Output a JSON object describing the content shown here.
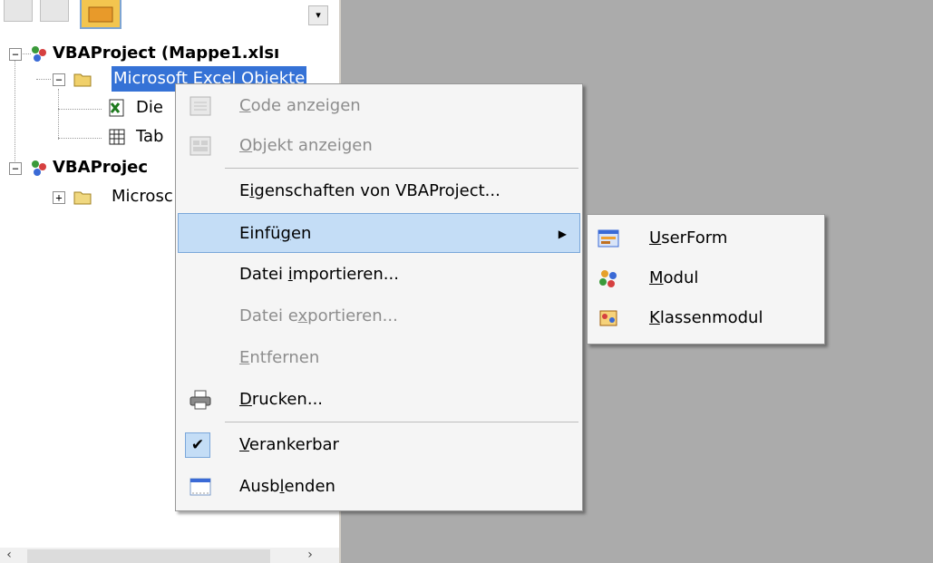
{
  "tree": {
    "project1": "VBAProject (Mappe1.xlsı",
    "folder1": "Microsoft Excel Objekte",
    "item_die": "Die",
    "item_tab": "Tab",
    "project2": "VBAProjec",
    "folder2": "Microsc",
    "expand_minus": "−",
    "expand_plus": "+"
  },
  "context_menu": {
    "items": [
      {
        "pre": "",
        "acc": "C",
        "post": "ode anzeigen"
      },
      {
        "pre": "",
        "acc": "O",
        "post": "bjekt anzeigen"
      },
      {
        "pre": "E",
        "acc": "i",
        "post": "genschaften von VBAProject..."
      },
      {
        "pre": "Einfü",
        "acc": "g",
        "post": "en"
      },
      {
        "pre": "Datei ",
        "acc": "i",
        "post": "mportieren..."
      },
      {
        "pre": "Datei e",
        "acc": "x",
        "post": "portieren..."
      },
      {
        "pre": "",
        "acc": "E",
        "post": "ntfernen"
      },
      {
        "pre": "",
        "acc": "D",
        "post": "rucken..."
      },
      {
        "pre": "",
        "acc": "V",
        "post": "erankerbar"
      },
      {
        "pre": "Ausb",
        "acc": "l",
        "post": "enden"
      }
    ],
    "submenu_arrow": "▶",
    "check_mark": "✔"
  },
  "sub_menu": {
    "items": [
      {
        "pre": "",
        "acc": "U",
        "post": "serForm"
      },
      {
        "pre": "",
        "acc": "M",
        "post": "odul"
      },
      {
        "pre": "",
        "acc": "K",
        "post": "lassenmodul"
      }
    ]
  },
  "scrollbar": {
    "left_arrow": "‹",
    "right_arrow": "›"
  },
  "colors": {
    "selection": "#3572d6",
    "menu_highlight": "#c4ddf6",
    "disabled_text": "#8d8d8d",
    "workspace": "#ababab"
  }
}
